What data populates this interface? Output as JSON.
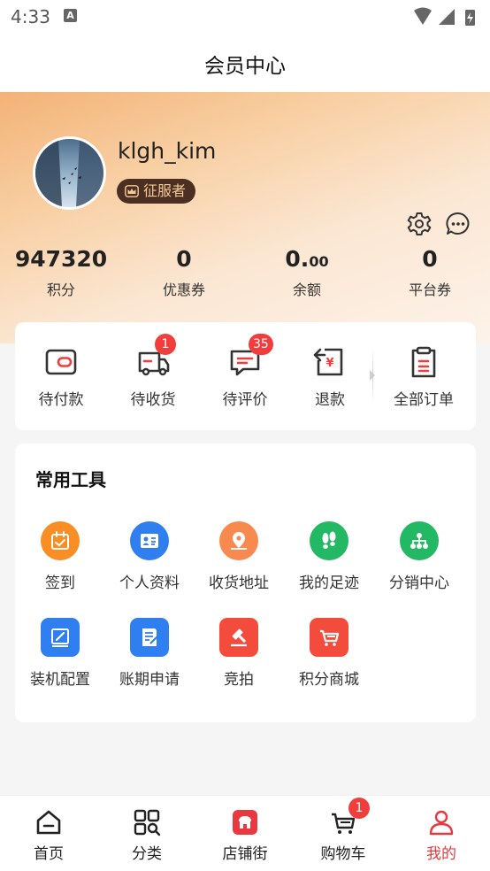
{
  "status_bar": {
    "time": "4:33",
    "notification_glyph": "A"
  },
  "nav": {
    "title": "会员中心"
  },
  "profile": {
    "username": "klgh_kim",
    "level_badge": "征服者"
  },
  "stats": [
    {
      "value": "947320",
      "label": "积分"
    },
    {
      "value": "0",
      "label": "优惠券"
    },
    {
      "value_main": "0.",
      "value_small": "00",
      "label": "余额"
    },
    {
      "value": "0",
      "label": "平台券"
    }
  ],
  "orders": [
    {
      "label": "待付款",
      "icon": "wallet-icon"
    },
    {
      "label": "待收货",
      "icon": "delivery-truck-icon",
      "badge": "1"
    },
    {
      "label": "待评价",
      "icon": "comment-icon",
      "badge": "35"
    },
    {
      "label": "退款",
      "icon": "refund-icon"
    },
    {
      "label": "全部订单",
      "icon": "clipboard-icon"
    }
  ],
  "tools": {
    "title": "常用工具",
    "items": [
      {
        "label": "签到",
        "icon": "calendar-check-icon",
        "color": "#f98e25"
      },
      {
        "label": "个人资料",
        "icon": "id-card-icon",
        "color": "#2f7ff0"
      },
      {
        "label": "收货地址",
        "icon": "location-pin-icon",
        "color": "#f88a4f"
      },
      {
        "label": "我的足迹",
        "icon": "footprint-icon",
        "color": "#22b864"
      },
      {
        "label": "分销中心",
        "icon": "org-chart-icon",
        "color": "#22b864"
      },
      {
        "label": "装机配置",
        "icon": "edit-icon",
        "color": "#2f7ff0"
      },
      {
        "label": "账期申请",
        "icon": "document-icon",
        "color": "#2f7ff0"
      },
      {
        "label": "竞拍",
        "icon": "gavel-icon",
        "color": "#f44c3c"
      },
      {
        "label": "积分商城",
        "icon": "cart-store-icon",
        "color": "#f44c3c"
      }
    ]
  },
  "tabbar": [
    {
      "label": "首页",
      "icon": "home-icon"
    },
    {
      "label": "分类",
      "icon": "category-icon"
    },
    {
      "label": "店铺街",
      "icon": "store-icon"
    },
    {
      "label": "购物车",
      "icon": "cart-icon",
      "badge": "1"
    },
    {
      "label": "我的",
      "icon": "user-icon",
      "active": true
    }
  ],
  "colors": {
    "accent_red": "#e9383f",
    "badge_red": "#f23d3d",
    "badge_brown": "#4a2f22"
  }
}
